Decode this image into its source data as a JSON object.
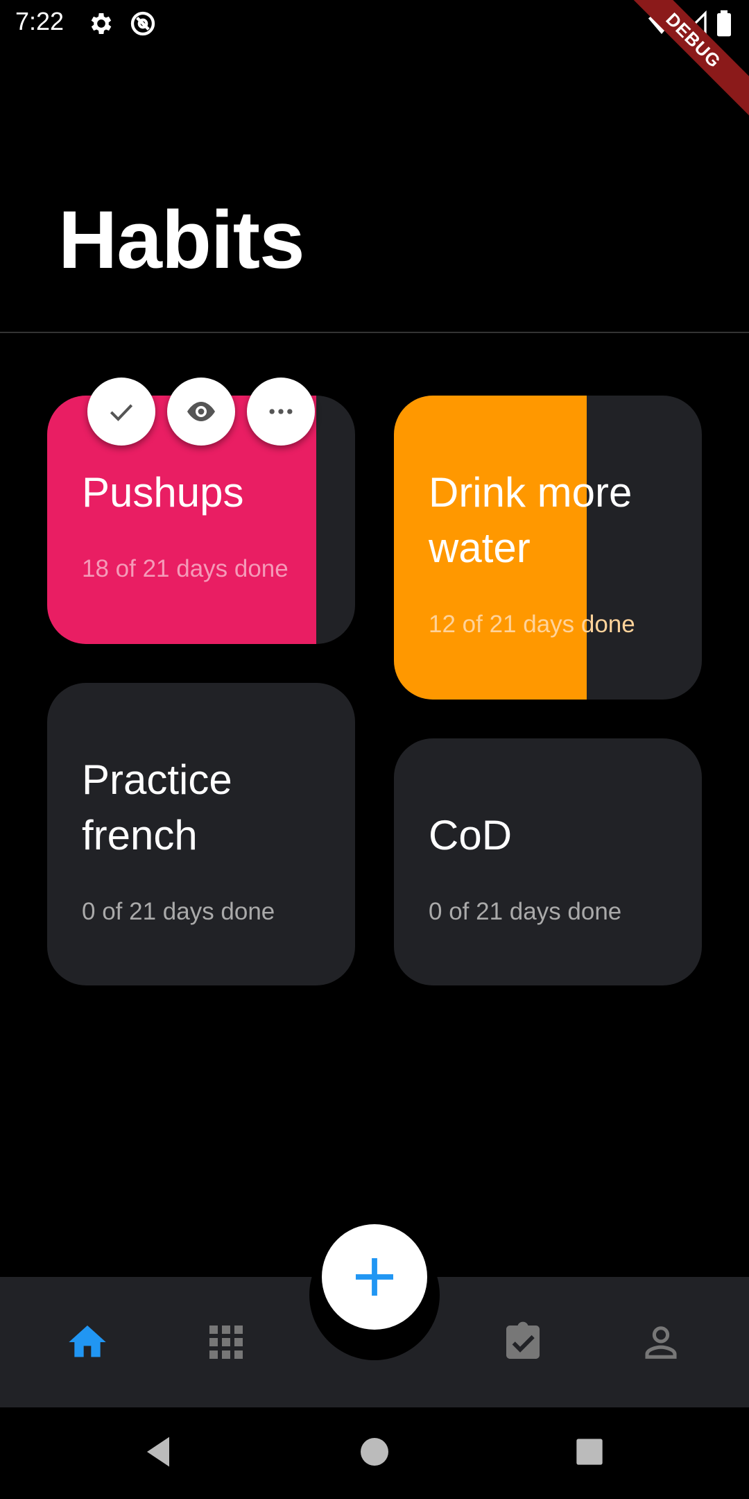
{
  "status_bar": {
    "time": "7:22",
    "debug_label": "DEBUG",
    "icons": [
      "gear-icon",
      "at-sign-icon",
      "wifi-icon",
      "signal-icon",
      "battery-icon"
    ]
  },
  "header": {
    "title": "Habits"
  },
  "habits": [
    {
      "title": "Pushups",
      "subtitle": "18 of 21 days done",
      "color": "#e91e63",
      "progress": 0.857
    },
    {
      "title": "Drink more water",
      "subtitle": "12 of 21 days done",
      "color": "#ff9800",
      "progress": 0.571
    },
    {
      "title": "Practice french",
      "subtitle": "0 of 21 days done",
      "color": "#212226",
      "progress": 0.0
    },
    {
      "title": "CoD",
      "subtitle": "0 of 21 days done",
      "color": "#212226",
      "progress": 0.0
    }
  ],
  "card_actions": [
    "check-icon",
    "eye-icon",
    "more-icon"
  ],
  "bottom_nav": {
    "items": [
      "home-icon",
      "grid-icon",
      "clipboard-check-icon",
      "person-icon"
    ],
    "active": "home-icon",
    "active_color": "#2196f3",
    "fab_icon": "plus-icon"
  },
  "system_nav": [
    "back-icon",
    "home-circle-icon",
    "recents-icon"
  ]
}
